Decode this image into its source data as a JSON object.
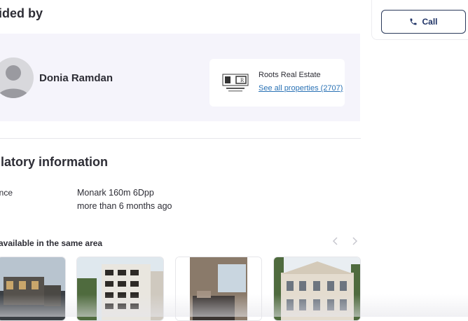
{
  "sections": {
    "provided_title": "vided by",
    "regulatory_title": "ulatory information",
    "similar_title": "available in the same area"
  },
  "agent": {
    "name": "Donia Ramdan"
  },
  "broker": {
    "name": "Roots Real Estate",
    "link": "See all properties (2707)"
  },
  "regulatory": {
    "label": "ence",
    "value1": "Monark 160m 6Dpp",
    "value2": "more than 6 months ago"
  },
  "actions": {
    "call": "Call"
  },
  "colors": {
    "accent": "#1f3366",
    "link": "#2a72b5",
    "panel": "#f5f4fb"
  }
}
